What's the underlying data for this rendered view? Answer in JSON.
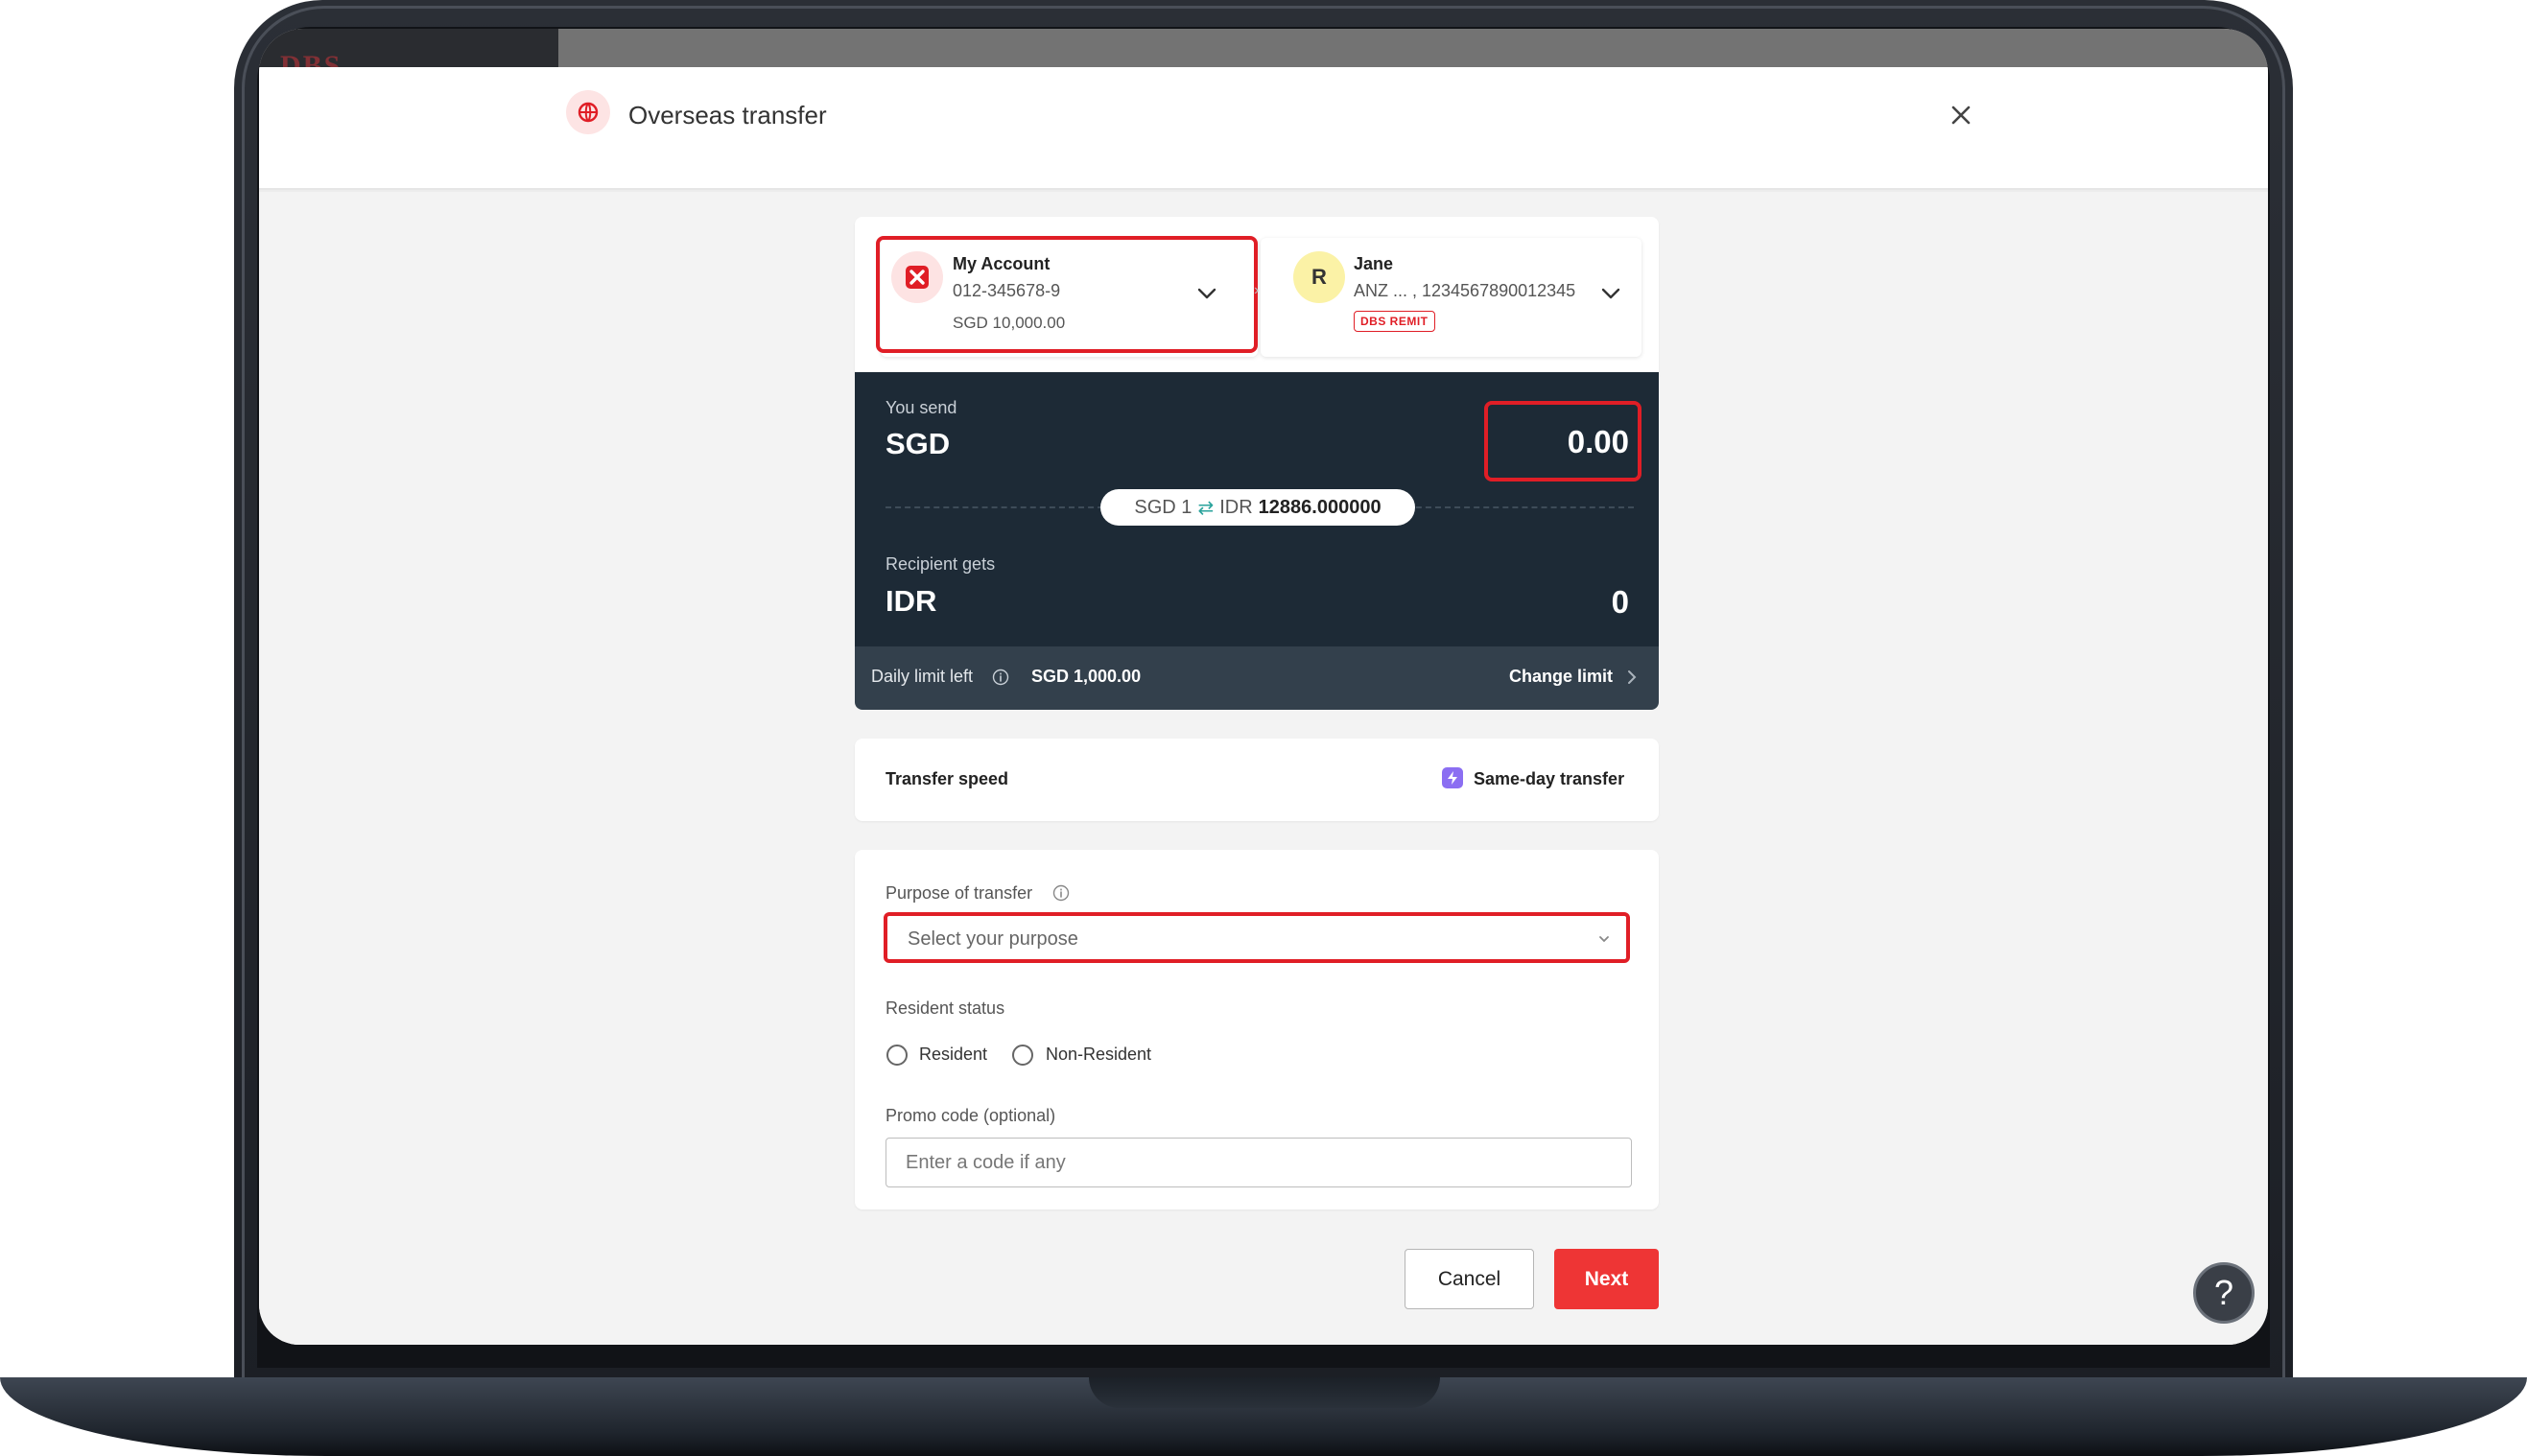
{
  "header": {
    "title": "Overseas transfer",
    "icon": "globe-icon",
    "close_icon": "close-icon"
  },
  "from_account": {
    "name": "My Account",
    "number": "012-345678-9",
    "balance": "SGD 10,000.00",
    "icon": "dbs-logo-icon"
  },
  "to_account": {
    "avatar_letter": "R",
    "name": "Jane",
    "details": "ANZ ... , 1234567890012345",
    "badge": "DBS REMIT"
  },
  "conversion": {
    "send_label": "You send",
    "send_currency": "SGD",
    "send_amount": "0.00",
    "rate_from": "SGD 1",
    "rate_to_currency": "IDR",
    "rate_value": "12886.000000",
    "receive_label": "Recipient gets",
    "receive_currency": "IDR",
    "receive_amount": "0"
  },
  "limit": {
    "label": "Daily limit left",
    "value": "SGD 1,000.00",
    "change_label": "Change limit"
  },
  "speed": {
    "label": "Transfer speed",
    "value": "Same-day transfer",
    "icon": "lightning-icon"
  },
  "form": {
    "purpose_label": "Purpose of transfer",
    "purpose_placeholder": "Select your purpose",
    "resident_label": "Resident status",
    "resident_options": [
      "Resident",
      "Non-Resident"
    ],
    "promo_label": "Promo code (optional)",
    "promo_placeholder": "Enter a code if any"
  },
  "buttons": {
    "cancel": "Cancel",
    "next": "Next",
    "help": "?"
  },
  "colors": {
    "accent_red": "#ee3535",
    "highlight_red": "#e01e26",
    "panel_dark": "#1d2a36"
  }
}
